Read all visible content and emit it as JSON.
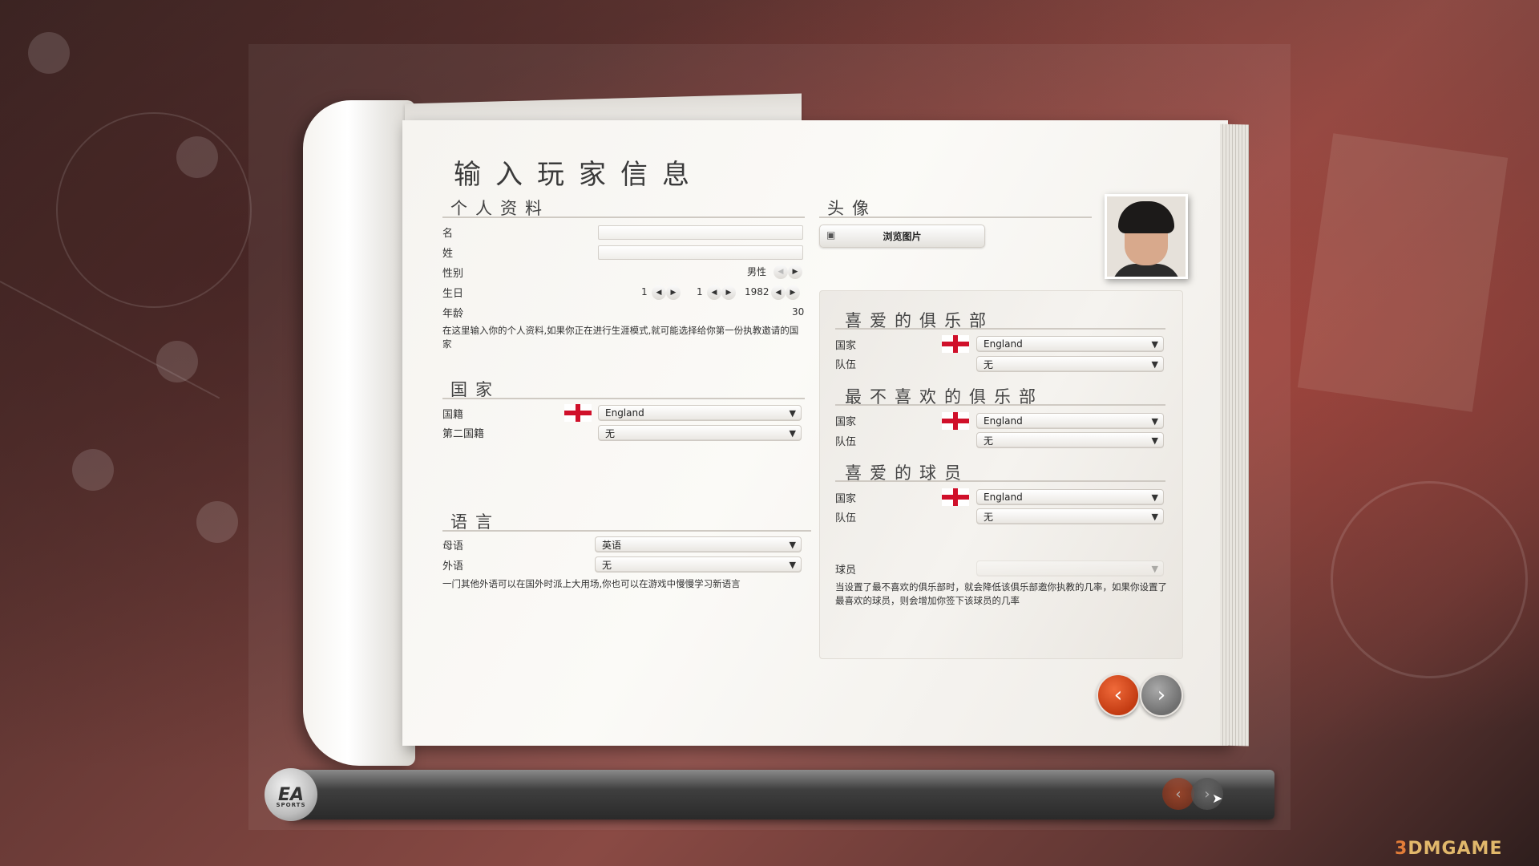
{
  "page": {
    "title": "输入玩家信息"
  },
  "personal": {
    "section_title": "个人资料",
    "first_name_label": "名",
    "first_name_value": "",
    "last_name_label": "姓",
    "last_name_value": "",
    "gender_label": "性别",
    "gender_value": "男性",
    "birthday_label": "生日",
    "birth_day": "1",
    "birth_month": "1",
    "birth_year": "1982",
    "age_label": "年龄",
    "age_value": "30",
    "note": "在这里输入你的个人资料,如果你正在进行生涯模式,就可能选择给你第一份执教邀请的国家"
  },
  "country": {
    "section_title": "国家",
    "nationality_label": "国籍",
    "nationality_value": "England",
    "second_nationality_label": "第二国籍",
    "second_nationality_value": "无"
  },
  "language": {
    "section_title": "语言",
    "native_label": "母语",
    "native_value": "英语",
    "foreign_label": "外语",
    "foreign_value": "无",
    "note": "一门其他外语可以在国外时派上大用场,你也可以在游戏中慢慢学习新语言"
  },
  "avatar": {
    "section_title": "头像",
    "browse_label": "浏览图片"
  },
  "favorite_club": {
    "section_title": "喜爱的俱乐部",
    "country_label": "国家",
    "country_value": "England",
    "team_label": "队伍",
    "team_value": "无"
  },
  "disliked_club": {
    "section_title": "最不喜欢的俱乐部",
    "country_label": "国家",
    "country_value": "England",
    "team_label": "队伍",
    "team_value": "无"
  },
  "favorite_player": {
    "section_title": "喜爱的球员",
    "country_label": "国家",
    "country_value": "England",
    "team_label": "队伍",
    "team_value": "无",
    "player_label": "球员",
    "player_value": "",
    "note": "当设置了最不喜欢的俱乐部时，就会降低该俱乐部邀你执教的几率，如果你设置了最喜欢的球员，则会增加你签下该球员的几率"
  },
  "bottom_bar": {
    "logo_text": "EA",
    "logo_sub": "SPORTS"
  },
  "watermark": {
    "prefix": "3",
    "text": "DMGAME"
  },
  "icons": {
    "left_arrow": "◀",
    "right_arrow": "▶",
    "dropdown_caret": "▼",
    "back_chevron": "‹",
    "next_chevron": "›"
  },
  "colors": {
    "accent_back": "#d0451c",
    "accent_next": "#8a8a8a",
    "flag_red": "#d0102a"
  }
}
